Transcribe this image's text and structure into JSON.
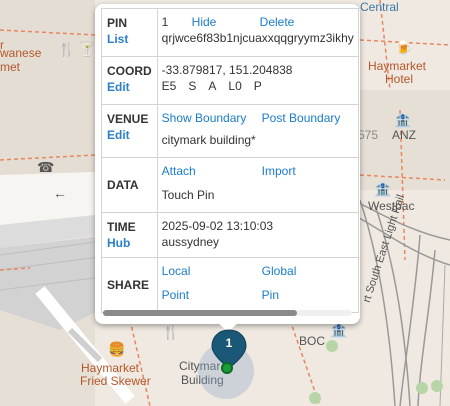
{
  "popup": {
    "pin": {
      "label": "PIN",
      "action": "List",
      "number": "1",
      "hide": "Hide",
      "delete": "Delete",
      "id": "qrjwce6f83b1njcuaxxqqgryymz3ikhy"
    },
    "coord": {
      "label": "COORD",
      "action": "Edit",
      "latlng": "-33.879817, 151.204838",
      "codes": [
        "E5",
        "S",
        "A",
        "L0",
        "P"
      ]
    },
    "venue": {
      "label": "VENUE",
      "action": "Edit",
      "show_boundary": "Show Boundary",
      "post_boundary": "Post Boundary",
      "name": "citymark building*"
    },
    "data": {
      "label": "DATA",
      "attach": "Attach",
      "import": "Import",
      "value": "Touch Pin"
    },
    "time": {
      "label": "TIME",
      "action": "Hub",
      "timestamp": "2025-09-02 13:10:03",
      "zone": "aussydney"
    },
    "share": {
      "label": "SHARE",
      "local": "Local",
      "global": "Global",
      "point": "Point",
      "pin": "Pin"
    }
  },
  "marker": {
    "number": "1",
    "color": "#1b5877",
    "dot_color": "#1a9e3a"
  },
  "map_labels": {
    "central": "Central",
    "waneseA": "r",
    "wanese": "wanese",
    "met": "met",
    "haymarket_hotel_1": "Haymarket",
    "haymarket_hotel_2": "Hotel",
    "anz": "ANZ",
    "n575": "575",
    "westpac": "Westpac",
    "haymarket_fried_1": "Haymarket",
    "haymarket_fried_2": "Fried Skewer",
    "citymark_1": "Citymar",
    "citymark_2": "Building",
    "boc": "BOC",
    "rail_label": "rt South East Light Rail"
  },
  "colors": {
    "link": "#1a7cc9",
    "map_bg": "#efe9e1",
    "road_orange": "#e8875f"
  }
}
